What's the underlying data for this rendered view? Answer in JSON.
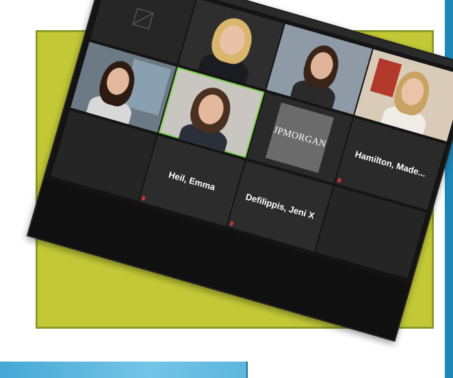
{
  "background": {
    "card_color": "#c3c936",
    "accent_bar_color": "#1f86b8"
  },
  "meeting": {
    "tile_labels": [
      {
        "label": "Heil, Emma"
      },
      {
        "label": "Defilippis, Jeni X"
      },
      {
        "label": "Hamilton, Made..."
      }
    ],
    "logo_text": "JPMORGAN"
  }
}
